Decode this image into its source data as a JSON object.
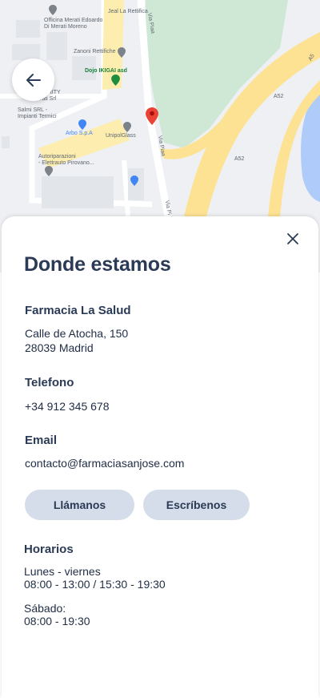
{
  "map": {
    "labels": [
      {
        "id": "jeal",
        "text": "Jeal La Rettifica"
      },
      {
        "id": "officina",
        "text": "Officina Merati Edoardo"
      },
      {
        "id": "officina2",
        "text": "Di Merati Moreno"
      },
      {
        "id": "zanoni",
        "text": "Zanoni Rettifiche"
      },
      {
        "id": "dojo",
        "text": "Dojo IKIGAI asd"
      },
      {
        "id": "security",
        "text": "SURITY"
      },
      {
        "id": "security2",
        "text": "rati Srl"
      },
      {
        "id": "salmi",
        "text": "Salmi SRL -"
      },
      {
        "id": "salmi2",
        "text": "Impianti Termici"
      },
      {
        "id": "arbo",
        "text": "Arbo S.p.A"
      },
      {
        "id": "unipol",
        "text": "UnipolGlass"
      },
      {
        "id": "autoriparazioni",
        "text": "Autoriparazioni"
      },
      {
        "id": "autoriparazioni2",
        "text": "- Elettrauto Pirovano..."
      },
      {
        "id": "viapiaa",
        "text": "Via Piaa"
      },
      {
        "id": "viapiaa2",
        "text": "Via Piaa"
      },
      {
        "id": "viapiaa3",
        "text": "Via Pi"
      },
      {
        "id": "a52",
        "text": "A52"
      },
      {
        "id": "a52b",
        "text": "A52"
      },
      {
        "id": "a52c",
        "text": "A5"
      }
    ],
    "colors": {
      "park": "#cfe8d6",
      "road": "#fde293",
      "water": "#aecbfa",
      "pin": "#ea4335"
    }
  },
  "panel": {
    "close_icon": "close-icon",
    "title": "Donde estamos",
    "pharmacy": {
      "name": "Farmacia La Salud",
      "address_line1": "Calle de Atocha, 150",
      "address_line2": "28039 Madrid"
    },
    "phone": {
      "label": "Telefono",
      "value": "+34 912 345 678"
    },
    "email": {
      "label": "Email",
      "value": "contacto@farmaciasanjose.com"
    },
    "buttons": {
      "call": "Llámanos",
      "write": "Escríbenos"
    },
    "hours": {
      "label": "Horarios",
      "weekdays_label": "Lunes - viernes",
      "weekdays_value": "08:00 - 13:00 / 15:30 - 19:30",
      "saturday_label": "Sábado:",
      "saturday_value": "08:00 - 19:30"
    }
  },
  "accent_color": "#d4dde9",
  "back_icon": "arrow-left-icon"
}
